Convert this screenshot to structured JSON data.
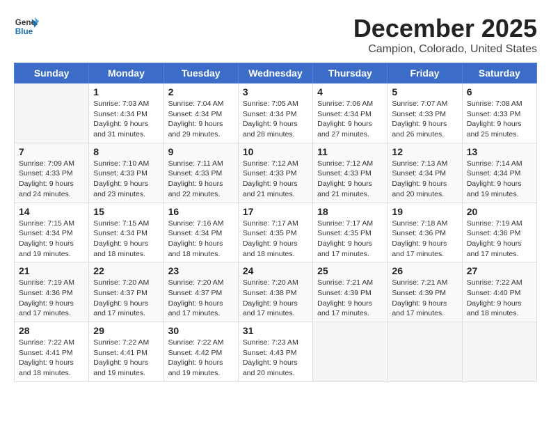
{
  "logo": {
    "line1": "General",
    "line2": "Blue"
  },
  "title": "December 2025",
  "subtitle": "Campion, Colorado, United States",
  "days_of_week": [
    "Sunday",
    "Monday",
    "Tuesday",
    "Wednesday",
    "Thursday",
    "Friday",
    "Saturday"
  ],
  "weeks": [
    [
      {
        "day": "",
        "info": ""
      },
      {
        "day": "1",
        "info": "Sunrise: 7:03 AM\nSunset: 4:34 PM\nDaylight: 9 hours\nand 31 minutes."
      },
      {
        "day": "2",
        "info": "Sunrise: 7:04 AM\nSunset: 4:34 PM\nDaylight: 9 hours\nand 29 minutes."
      },
      {
        "day": "3",
        "info": "Sunrise: 7:05 AM\nSunset: 4:34 PM\nDaylight: 9 hours\nand 28 minutes."
      },
      {
        "day": "4",
        "info": "Sunrise: 7:06 AM\nSunset: 4:34 PM\nDaylight: 9 hours\nand 27 minutes."
      },
      {
        "day": "5",
        "info": "Sunrise: 7:07 AM\nSunset: 4:33 PM\nDaylight: 9 hours\nand 26 minutes."
      },
      {
        "day": "6",
        "info": "Sunrise: 7:08 AM\nSunset: 4:33 PM\nDaylight: 9 hours\nand 25 minutes."
      }
    ],
    [
      {
        "day": "7",
        "info": "Sunrise: 7:09 AM\nSunset: 4:33 PM\nDaylight: 9 hours\nand 24 minutes."
      },
      {
        "day": "8",
        "info": "Sunrise: 7:10 AM\nSunset: 4:33 PM\nDaylight: 9 hours\nand 23 minutes."
      },
      {
        "day": "9",
        "info": "Sunrise: 7:11 AM\nSunset: 4:33 PM\nDaylight: 9 hours\nand 22 minutes."
      },
      {
        "day": "10",
        "info": "Sunrise: 7:12 AM\nSunset: 4:33 PM\nDaylight: 9 hours\nand 21 minutes."
      },
      {
        "day": "11",
        "info": "Sunrise: 7:12 AM\nSunset: 4:33 PM\nDaylight: 9 hours\nand 21 minutes."
      },
      {
        "day": "12",
        "info": "Sunrise: 7:13 AM\nSunset: 4:34 PM\nDaylight: 9 hours\nand 20 minutes."
      },
      {
        "day": "13",
        "info": "Sunrise: 7:14 AM\nSunset: 4:34 PM\nDaylight: 9 hours\nand 19 minutes."
      }
    ],
    [
      {
        "day": "14",
        "info": "Sunrise: 7:15 AM\nSunset: 4:34 PM\nDaylight: 9 hours\nand 19 minutes."
      },
      {
        "day": "15",
        "info": "Sunrise: 7:15 AM\nSunset: 4:34 PM\nDaylight: 9 hours\nand 18 minutes."
      },
      {
        "day": "16",
        "info": "Sunrise: 7:16 AM\nSunset: 4:34 PM\nDaylight: 9 hours\nand 18 minutes."
      },
      {
        "day": "17",
        "info": "Sunrise: 7:17 AM\nSunset: 4:35 PM\nDaylight: 9 hours\nand 18 minutes."
      },
      {
        "day": "18",
        "info": "Sunrise: 7:17 AM\nSunset: 4:35 PM\nDaylight: 9 hours\nand 17 minutes."
      },
      {
        "day": "19",
        "info": "Sunrise: 7:18 AM\nSunset: 4:36 PM\nDaylight: 9 hours\nand 17 minutes."
      },
      {
        "day": "20",
        "info": "Sunrise: 7:19 AM\nSunset: 4:36 PM\nDaylight: 9 hours\nand 17 minutes."
      }
    ],
    [
      {
        "day": "21",
        "info": "Sunrise: 7:19 AM\nSunset: 4:36 PM\nDaylight: 9 hours\nand 17 minutes."
      },
      {
        "day": "22",
        "info": "Sunrise: 7:20 AM\nSunset: 4:37 PM\nDaylight: 9 hours\nand 17 minutes."
      },
      {
        "day": "23",
        "info": "Sunrise: 7:20 AM\nSunset: 4:37 PM\nDaylight: 9 hours\nand 17 minutes."
      },
      {
        "day": "24",
        "info": "Sunrise: 7:20 AM\nSunset: 4:38 PM\nDaylight: 9 hours\nand 17 minutes."
      },
      {
        "day": "25",
        "info": "Sunrise: 7:21 AM\nSunset: 4:39 PM\nDaylight: 9 hours\nand 17 minutes."
      },
      {
        "day": "26",
        "info": "Sunrise: 7:21 AM\nSunset: 4:39 PM\nDaylight: 9 hours\nand 17 minutes."
      },
      {
        "day": "27",
        "info": "Sunrise: 7:22 AM\nSunset: 4:40 PM\nDaylight: 9 hours\nand 18 minutes."
      }
    ],
    [
      {
        "day": "28",
        "info": "Sunrise: 7:22 AM\nSunset: 4:41 PM\nDaylight: 9 hours\nand 18 minutes."
      },
      {
        "day": "29",
        "info": "Sunrise: 7:22 AM\nSunset: 4:41 PM\nDaylight: 9 hours\nand 19 minutes."
      },
      {
        "day": "30",
        "info": "Sunrise: 7:22 AM\nSunset: 4:42 PM\nDaylight: 9 hours\nand 19 minutes."
      },
      {
        "day": "31",
        "info": "Sunrise: 7:23 AM\nSunset: 4:43 PM\nDaylight: 9 hours\nand 20 minutes."
      },
      {
        "day": "",
        "info": ""
      },
      {
        "day": "",
        "info": ""
      },
      {
        "day": "",
        "info": ""
      }
    ]
  ]
}
